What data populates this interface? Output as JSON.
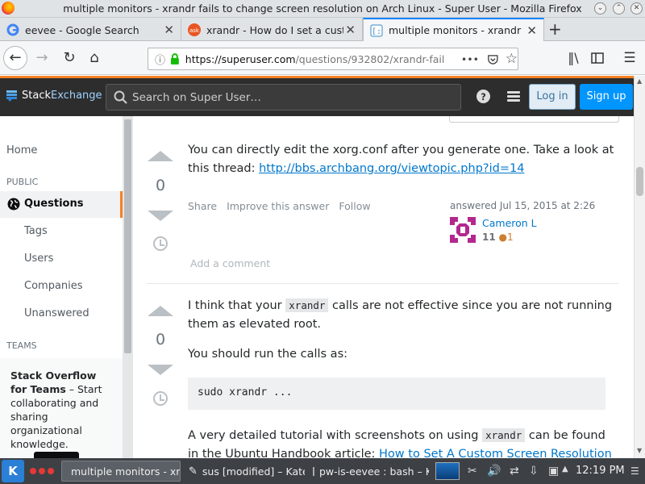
{
  "window": {
    "title": "multiple monitors - xrandr fails to change screen resolution on Arch Linux - Super User - Mozilla Firefox"
  },
  "tabs": [
    {
      "label": "eevee - Google Search",
      "icon": "google-icon"
    },
    {
      "label": "xrandr - How do I set a custom",
      "icon": "askubuntu-icon"
    },
    {
      "label": "multiple monitors - xrandr fail",
      "icon": "superuser-icon"
    }
  ],
  "nav": {
    "url_host": "https://superuser.com",
    "url_path": "/questions/932802/xrandr-fail",
    "url_dots": "•••"
  },
  "header": {
    "brand_a": "Stack",
    "brand_b": "Exchange",
    "search_placeholder": "Search on Super User…",
    "login": "Log in",
    "signup": "Sign up"
  },
  "sidebar": {
    "home": "Home",
    "public_label": "PUBLIC",
    "questions": "Questions",
    "tags": "Tags",
    "users": "Users",
    "companies": "Companies",
    "unanswered": "Unanswered",
    "teams_label": "TEAMS",
    "teams_title": "Stack Overflow for Teams",
    "teams_text": " – Start collaborating and sharing organizational knowledge."
  },
  "answer1": {
    "votes": "0",
    "text_before": "You can directly edit the xorg.conf after you generate one. Take a look at this thread: ",
    "link": "http://bbs.archbang.org/viewtopic.php?id=14",
    "share": "Share",
    "improve": "Improve this answer",
    "follow": "Follow",
    "answered": "answered Jul 15, 2015 at 2:26",
    "user": "Cameron L",
    "rep": "11",
    "bronze": "●1",
    "add_comment": "Add a comment"
  },
  "answer2": {
    "votes": "0",
    "p1_a": "I think that your ",
    "p1_code": "xrandr",
    "p1_b": " calls are not effective since you are not running them as elevated root.",
    "p2": "You should run the calls as:",
    "code": "sudo xrandr ...",
    "p3_a": "A very detailed tutorial with screenshots on using ",
    "p3_code": "xrandr",
    "p3_b": " can be found in the Ubuntu Handbook article: ",
    "p3_link": "How to Set A Custom Screen Resolution in Ubuntu"
  },
  "taskbar": {
    "tasks": [
      {
        "label": "multiple monitors - xr",
        "icon": "firefox-icon"
      },
      {
        "label": "sus [modified] – Kate",
        "icon": "kate-icon"
      },
      {
        "label": "pw-is-eevee : bash – K",
        "icon": "terminal-icon"
      }
    ],
    "clock": "12:19 PM"
  },
  "colors": {
    "accent": "#f48024",
    "link": "#0077cc",
    "signup": "#0095ff",
    "header": "#2d2d2d"
  }
}
